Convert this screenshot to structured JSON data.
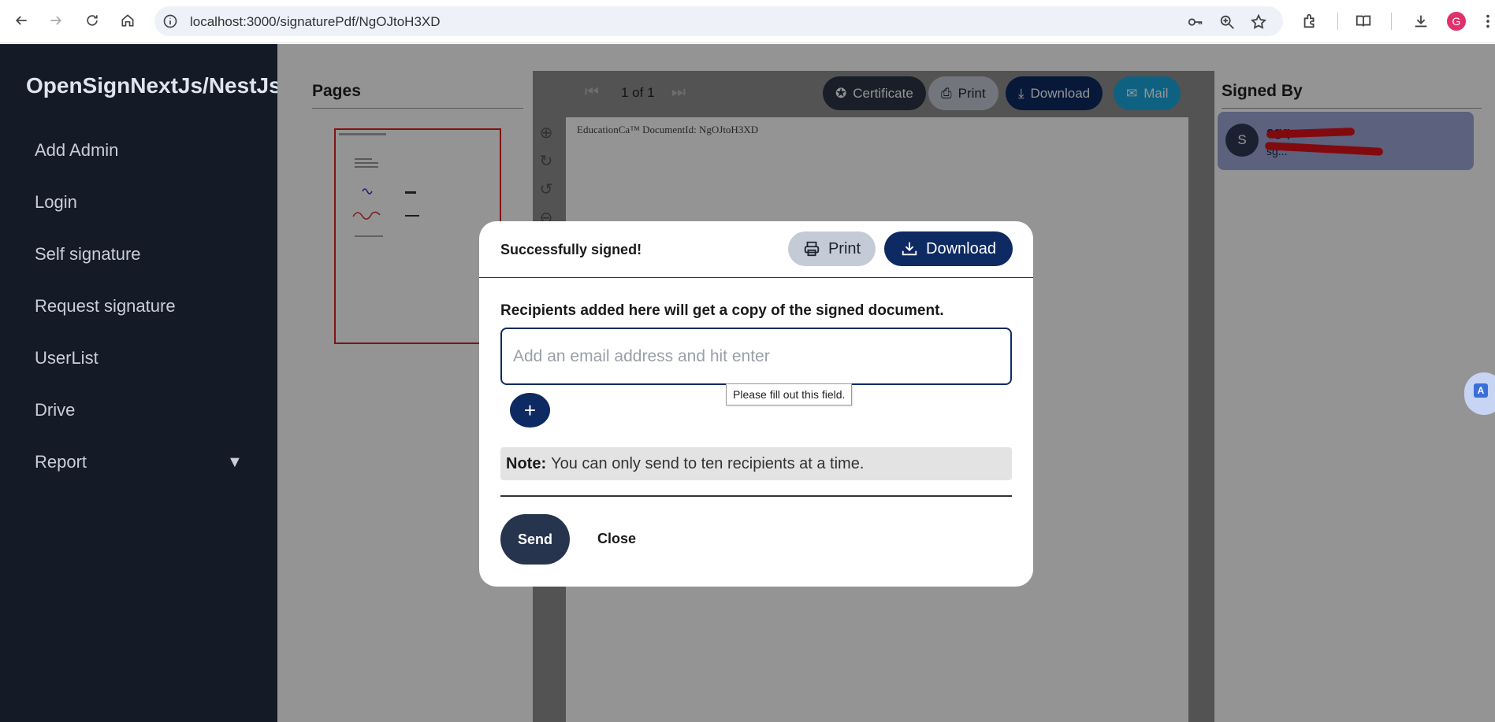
{
  "browser": {
    "url": "localhost:3000/signaturePdf/NgOJtoH3XD",
    "profile_initial": "G"
  },
  "sidebar": {
    "brand": "OpenSignNextJs/NestJs",
    "items": [
      {
        "label": "Add Admin"
      },
      {
        "label": "Login"
      },
      {
        "label": "Self signature"
      },
      {
        "label": "Request signature"
      },
      {
        "label": "UserList"
      },
      {
        "label": "Drive"
      },
      {
        "label": "Report"
      }
    ],
    "report_caret": "▼"
  },
  "viewer": {
    "pages_title": "Pages",
    "page_counter": "1 of 1",
    "doc_header": "EducationCa™ DocumentId: NgOJtoH3XD",
    "toolbar": {
      "certificate": "Certificate",
      "print": "Print",
      "download": "Download",
      "mail": "Mail"
    },
    "signed_by_title": "Signed By",
    "signer": {
      "initial": "S",
      "name": "sgq",
      "email": "sg..."
    }
  },
  "modal": {
    "title": "Successfully signed!",
    "print_label": "Print",
    "download_label": "Download",
    "instruction": "Recipients added here will get a copy of the signed document.",
    "email_placeholder": "Add an email address and hit enter",
    "tooltip": "Please fill out this field.",
    "add_symbol": "+",
    "note_label": "Note:",
    "note_text": "You can only send to ten recipients at a time.",
    "send_label": "Send",
    "close_label": "Close"
  },
  "colors": {
    "sidebar_bg": "#141a26",
    "primary": "#0d2a63",
    "send_bg": "#27344e",
    "mail_btn": "#1aa7e0",
    "signer_card": "#9fa8d8"
  }
}
